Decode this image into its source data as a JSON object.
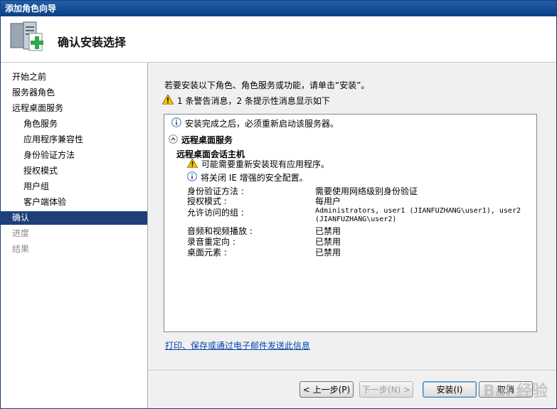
{
  "window": {
    "title": "添加角色向导"
  },
  "header": {
    "title": "确认安装选择",
    "icon": "server-add-icon"
  },
  "sidebar": {
    "items": [
      {
        "label": "开始之前",
        "state": "normal"
      },
      {
        "label": "服务器角色",
        "state": "normal"
      },
      {
        "label": "远程桌面服务",
        "state": "normal"
      },
      {
        "label": "角色服务",
        "state": "normal"
      },
      {
        "label": "应用程序兼容性",
        "state": "normal"
      },
      {
        "label": "身份验证方法",
        "state": "normal"
      },
      {
        "label": "授权模式",
        "state": "normal"
      },
      {
        "label": "用户组",
        "state": "normal"
      },
      {
        "label": "客户端体验",
        "state": "normal"
      },
      {
        "label": "确认",
        "state": "active"
      },
      {
        "label": "进度",
        "state": "disabled"
      },
      {
        "label": "结果",
        "state": "disabled"
      }
    ]
  },
  "main": {
    "intro": "若要安装以下角色、角色服务或功能，请单击“安装”。",
    "warning_summary": "1 条警告消息，2 条提示性消息显示如下",
    "report": {
      "restart_info": "安装完成之后，必须重新启动该服务器。",
      "section_title": "远程桌面服务",
      "sub_title": "远程桌面会话主机",
      "warning_reinstall": "可能需要重新安装现有应用程序。",
      "info_ie": "将关闭 IE 增强的安全配置。",
      "properties": [
        {
          "key": "身份验证方法 :",
          "value": "需要使用网络级别身份验证"
        },
        {
          "key": "授权模式 :",
          "value": "每用户"
        },
        {
          "key": "允许访问的组 :",
          "value": "Administrators, user1 (JIANFUZHANG\\user1), user2 (JIANFUZHANG\\user2)"
        },
        {
          "key": "音频和视频播放 :",
          "value": "已禁用"
        },
        {
          "key": "录音重定向 :",
          "value": "已禁用"
        },
        {
          "key": "桌面元素 :",
          "value": "已禁用"
        }
      ]
    },
    "link": "打印、保存或通过电子邮件发送此信息"
  },
  "buttons": {
    "back": "< 上一步(P)",
    "next": "下一步(N) >",
    "install": "安装(I)",
    "cancel": "取消"
  },
  "watermark": "Bai 经验"
}
